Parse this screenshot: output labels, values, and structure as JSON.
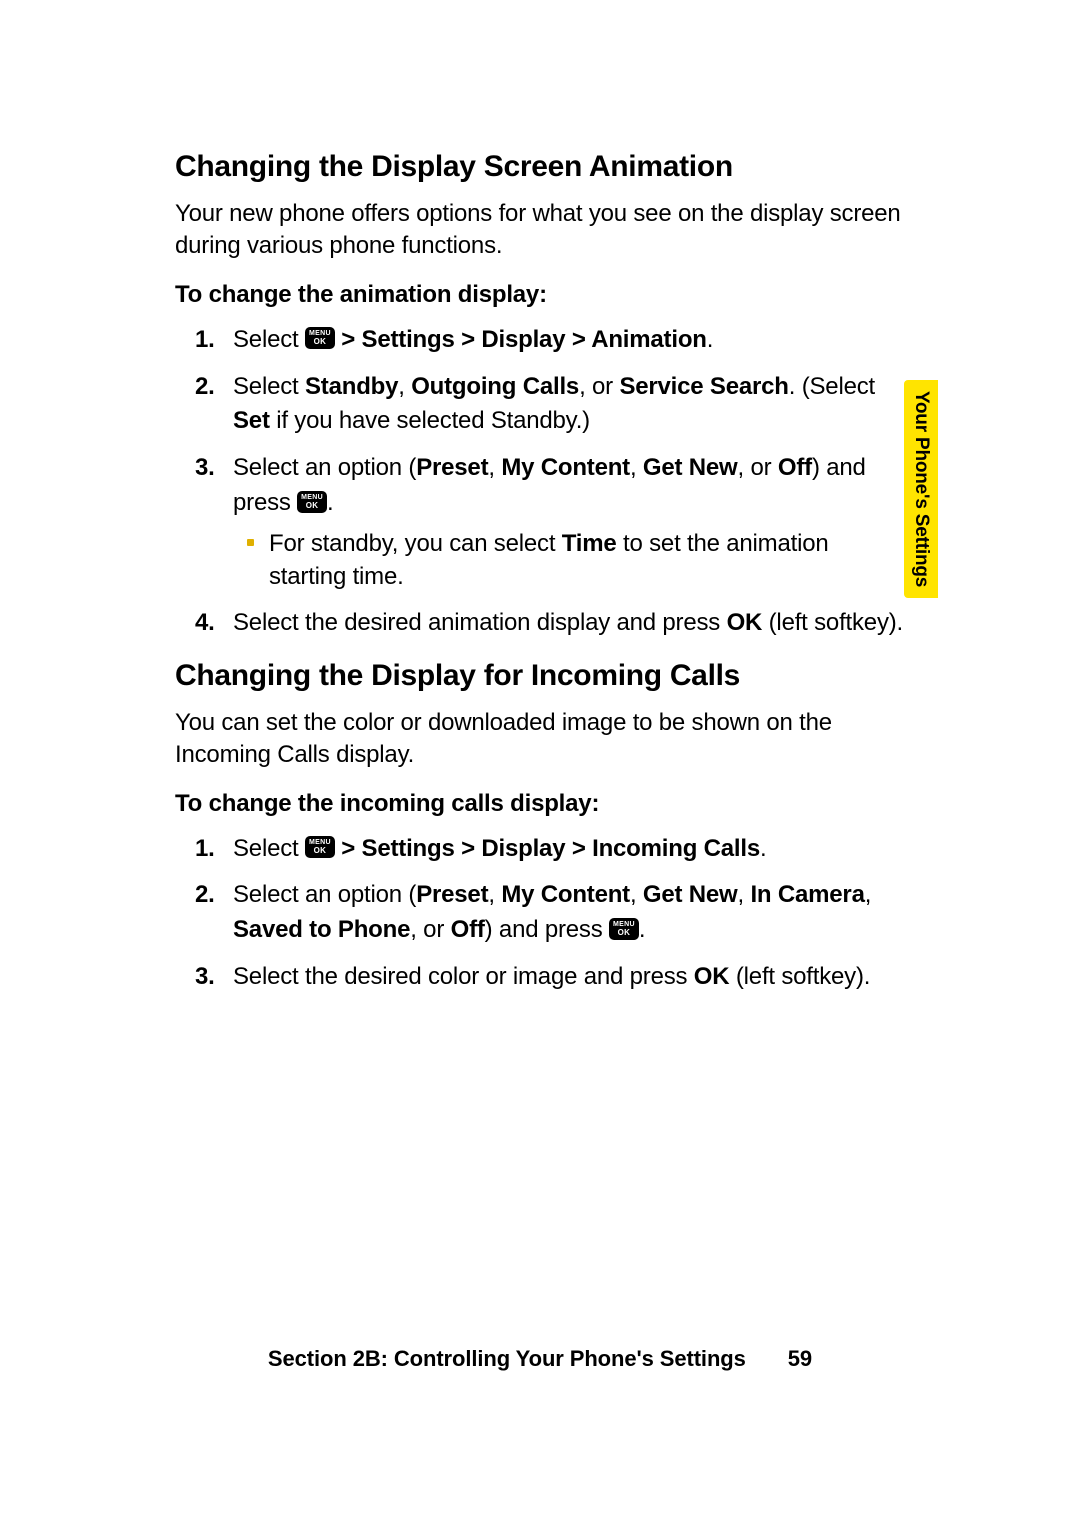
{
  "side_tab": "Your Phone's Settings",
  "section1": {
    "heading": "Changing the Display Screen Animation",
    "intro": "Your new phone offers options for what you see on the display screen during various phone functions.",
    "sub": "To change the animation display:",
    "steps": {
      "s1_pre": "Select ",
      "s1_post": " > Settings > Display > Animation",
      "s1_end": ".",
      "s2_a": "Select ",
      "s2_b": "Standby",
      "s2_c": ", ",
      "s2_d": "Outgoing Calls",
      "s2_e": ", or ",
      "s2_f": "Service Search",
      "s2_g": ". (Select ",
      "s2_h": "Set",
      "s2_i": " if you have selected Standby.)",
      "s3_a": "Select an option (",
      "s3_b": "Preset",
      "s3_c": ", ",
      "s3_d": "My Content",
      "s3_e": ", ",
      "s3_f": "Get New",
      "s3_g": ", or ",
      "s3_h": "Off",
      "s3_i": ") and press ",
      "s3_j": ".",
      "s3_bullet_a": "For standby, you can select ",
      "s3_bullet_b": "Time",
      "s3_bullet_c": " to set the animation starting time.",
      "s4_a": "Select the desired animation display and press ",
      "s4_b": "OK",
      "s4_c": " (left softkey)."
    }
  },
  "section2": {
    "heading": "Changing the Display for Incoming Calls",
    "intro": "You can set the color or downloaded image to be shown on the Incoming Calls display.",
    "sub": "To change the incoming calls display:",
    "steps": {
      "s1_pre": "Select ",
      "s1_post": " > Settings > Display > Incoming Calls",
      "s1_end": ".",
      "s2_a": "Select an option (",
      "s2_b": "Preset",
      "s2_c": ", ",
      "s2_d": "My Content",
      "s2_e": ", ",
      "s2_f": "Get New",
      "s2_g": ", ",
      "s2_h": "In Camera",
      "s2_i": ", ",
      "s2_j": "Saved to Phone",
      "s2_k": ", or ",
      "s2_l": "Off",
      "s2_m": ") and press ",
      "s2_n": ".",
      "s3_a": "Select the desired color or image and press ",
      "s3_b": "OK",
      "s3_c": " (left softkey)."
    }
  },
  "footer": {
    "label": "Section 2B: Controlling Your Phone's Settings",
    "page": "59"
  },
  "icon": {
    "top": "MENU",
    "bot": "OK"
  }
}
